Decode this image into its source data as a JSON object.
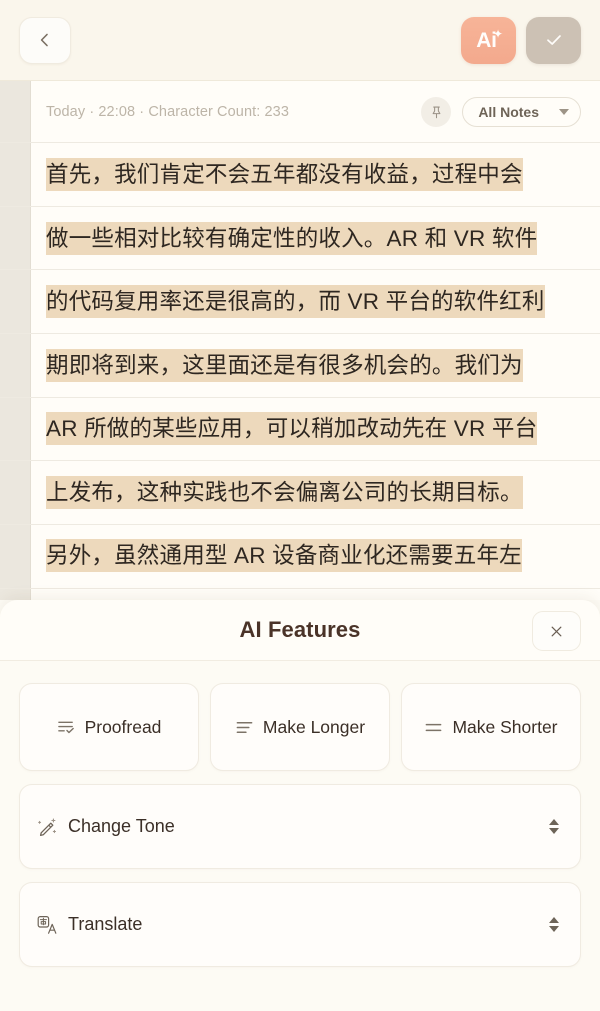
{
  "header": {
    "back_icon": "chevron-left-icon",
    "ai_button_label": "Ai",
    "ai_button_sparkle": "✦",
    "done_icon": "check-icon",
    "accent_ai": "#f3a98d",
    "accent_done": "#ccc1b4"
  },
  "note": {
    "meta": "Today · 22:08 · Character Count: 233",
    "pin_icon": "pin-icon",
    "filter_label": "All Notes",
    "filter_caret": "chevron-down-icon",
    "highlight_color": "#edd9bc",
    "lines": [
      "首先，我们肯定不会五年都没有收益，过程中会",
      "做一些相对比较有确定性的收入。AR 和 VR 软件",
      "的代码复用率还是很高的，而 VR 平台的软件红利",
      "期即将到来，这里面还是有很多机会的。我们为",
      "AR 所做的某些应用，可以稍加改动先在 VR 平台",
      "上发布，这种实践也不会偏离公司的长期目标。",
      "另外，虽然通用型 AR 设备商业化还需要五年左"
    ]
  },
  "ai_sheet": {
    "title": "AI Features",
    "close_icon": "close-icon",
    "quick_actions": [
      {
        "label": "Proofread",
        "icon": "proofread-lines-check-icon"
      },
      {
        "label": "Make Longer",
        "icon": "lines-expand-icon"
      },
      {
        "label": "Make Shorter",
        "icon": "lines-shrink-icon"
      }
    ],
    "expandable_actions": [
      {
        "label": "Change Tone",
        "icon": "magic-wand-icon",
        "control": "stepper-icon"
      },
      {
        "label": "Translate",
        "icon": "translate-icon",
        "control": "stepper-icon"
      }
    ]
  }
}
